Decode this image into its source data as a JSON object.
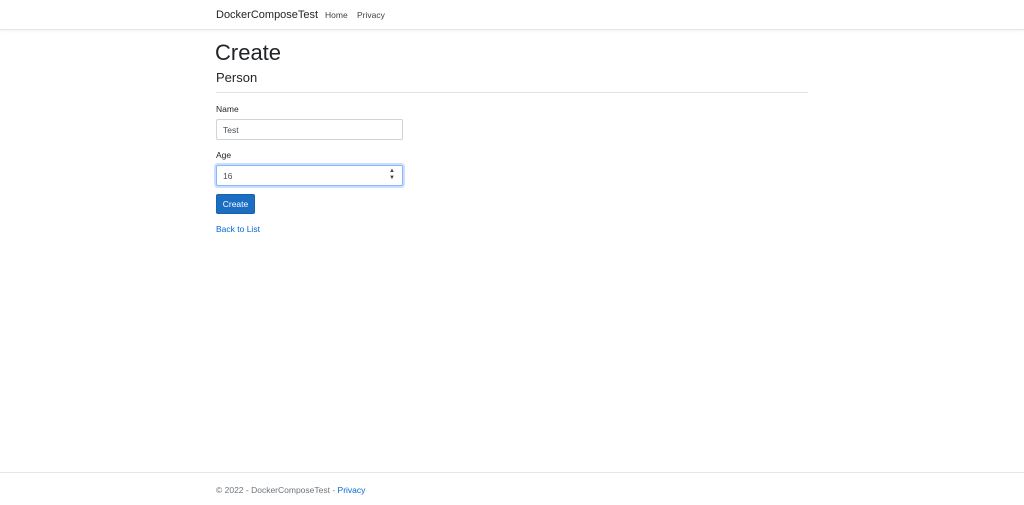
{
  "navbar": {
    "brand": "DockerComposeTest",
    "links": [
      {
        "label": "Home"
      },
      {
        "label": "Privacy"
      }
    ]
  },
  "page": {
    "title": "Create",
    "subtitle": "Person"
  },
  "form": {
    "name": {
      "label": "Name",
      "value": "Test"
    },
    "age": {
      "label": "Age",
      "value": "16"
    },
    "submit_label": "Create"
  },
  "back_link": "Back to List",
  "footer": {
    "copyright": "© 2022 - DockerComposeTest - ",
    "privacy_link": "Privacy"
  },
  "colors": {
    "primary_button": "#1b6ec2",
    "link": "#0366d6",
    "focus_ring": "#86b7fe"
  }
}
